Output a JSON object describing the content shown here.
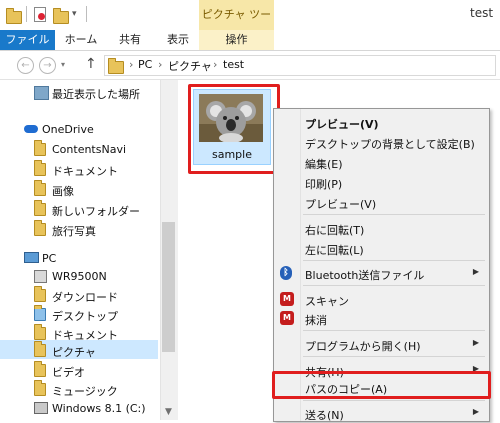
{
  "window": {
    "title": "test",
    "context_tab_header": "ピクチャ ツール"
  },
  "ribbon": {
    "tabs": [
      {
        "label": "ファイル"
      },
      {
        "label": "ホーム"
      },
      {
        "label": "共有"
      },
      {
        "label": "表示"
      },
      {
        "label": "操作"
      }
    ]
  },
  "address": {
    "crumbs": [
      "PC",
      "ピクチャ",
      "test"
    ]
  },
  "nav": {
    "items": [
      {
        "label": "最近表示した場所",
        "icon": "recent-places-icon"
      },
      {
        "label": "OneDrive",
        "icon": "onedrive-icon"
      },
      {
        "label": "ContentsNavi",
        "icon": "folder-icon"
      },
      {
        "label": "ドキュメント",
        "icon": "folder-icon"
      },
      {
        "label": "画像",
        "icon": "folder-icon"
      },
      {
        "label": "新しいフォルダー",
        "icon": "folder-icon"
      },
      {
        "label": "旅行写真",
        "icon": "folder-icon"
      },
      {
        "label": "PC",
        "icon": "computer-icon"
      },
      {
        "label": "WR9500N",
        "icon": "network-device-icon"
      },
      {
        "label": "ダウンロード",
        "icon": "downloads-icon"
      },
      {
        "label": "デスクトップ",
        "icon": "desktop-icon"
      },
      {
        "label": "ドキュメント",
        "icon": "documents-icon"
      },
      {
        "label": "ピクチャ",
        "icon": "pictures-icon"
      },
      {
        "label": "ビデオ",
        "icon": "videos-icon"
      },
      {
        "label": "ミュージック",
        "icon": "music-icon"
      },
      {
        "label": "Windows 8.1 (C:)",
        "icon": "drive-icon"
      }
    ]
  },
  "file": {
    "name": "sample"
  },
  "menu": {
    "items": [
      {
        "label": "プレビュー(V)"
      },
      {
        "label": "デスクトップの背景として設定(B)"
      },
      {
        "label": "編集(E)"
      },
      {
        "label": "印刷(P)"
      },
      {
        "label": "プレビュー(V)"
      },
      {
        "label": "右に回転(T)"
      },
      {
        "label": "左に回転(L)"
      },
      {
        "label": "Bluetooth送信ファイル"
      },
      {
        "label": "スキャン"
      },
      {
        "label": "抹消"
      },
      {
        "label": "プログラムから開く(H)"
      },
      {
        "label": "共有(H)"
      },
      {
        "label": "パスのコピー(A)"
      },
      {
        "label": "送る(N)"
      }
    ]
  },
  "colors": {
    "file_tab": "#1979ca",
    "highlight_red": "#e01e1e",
    "selection": "#cce8ff"
  }
}
